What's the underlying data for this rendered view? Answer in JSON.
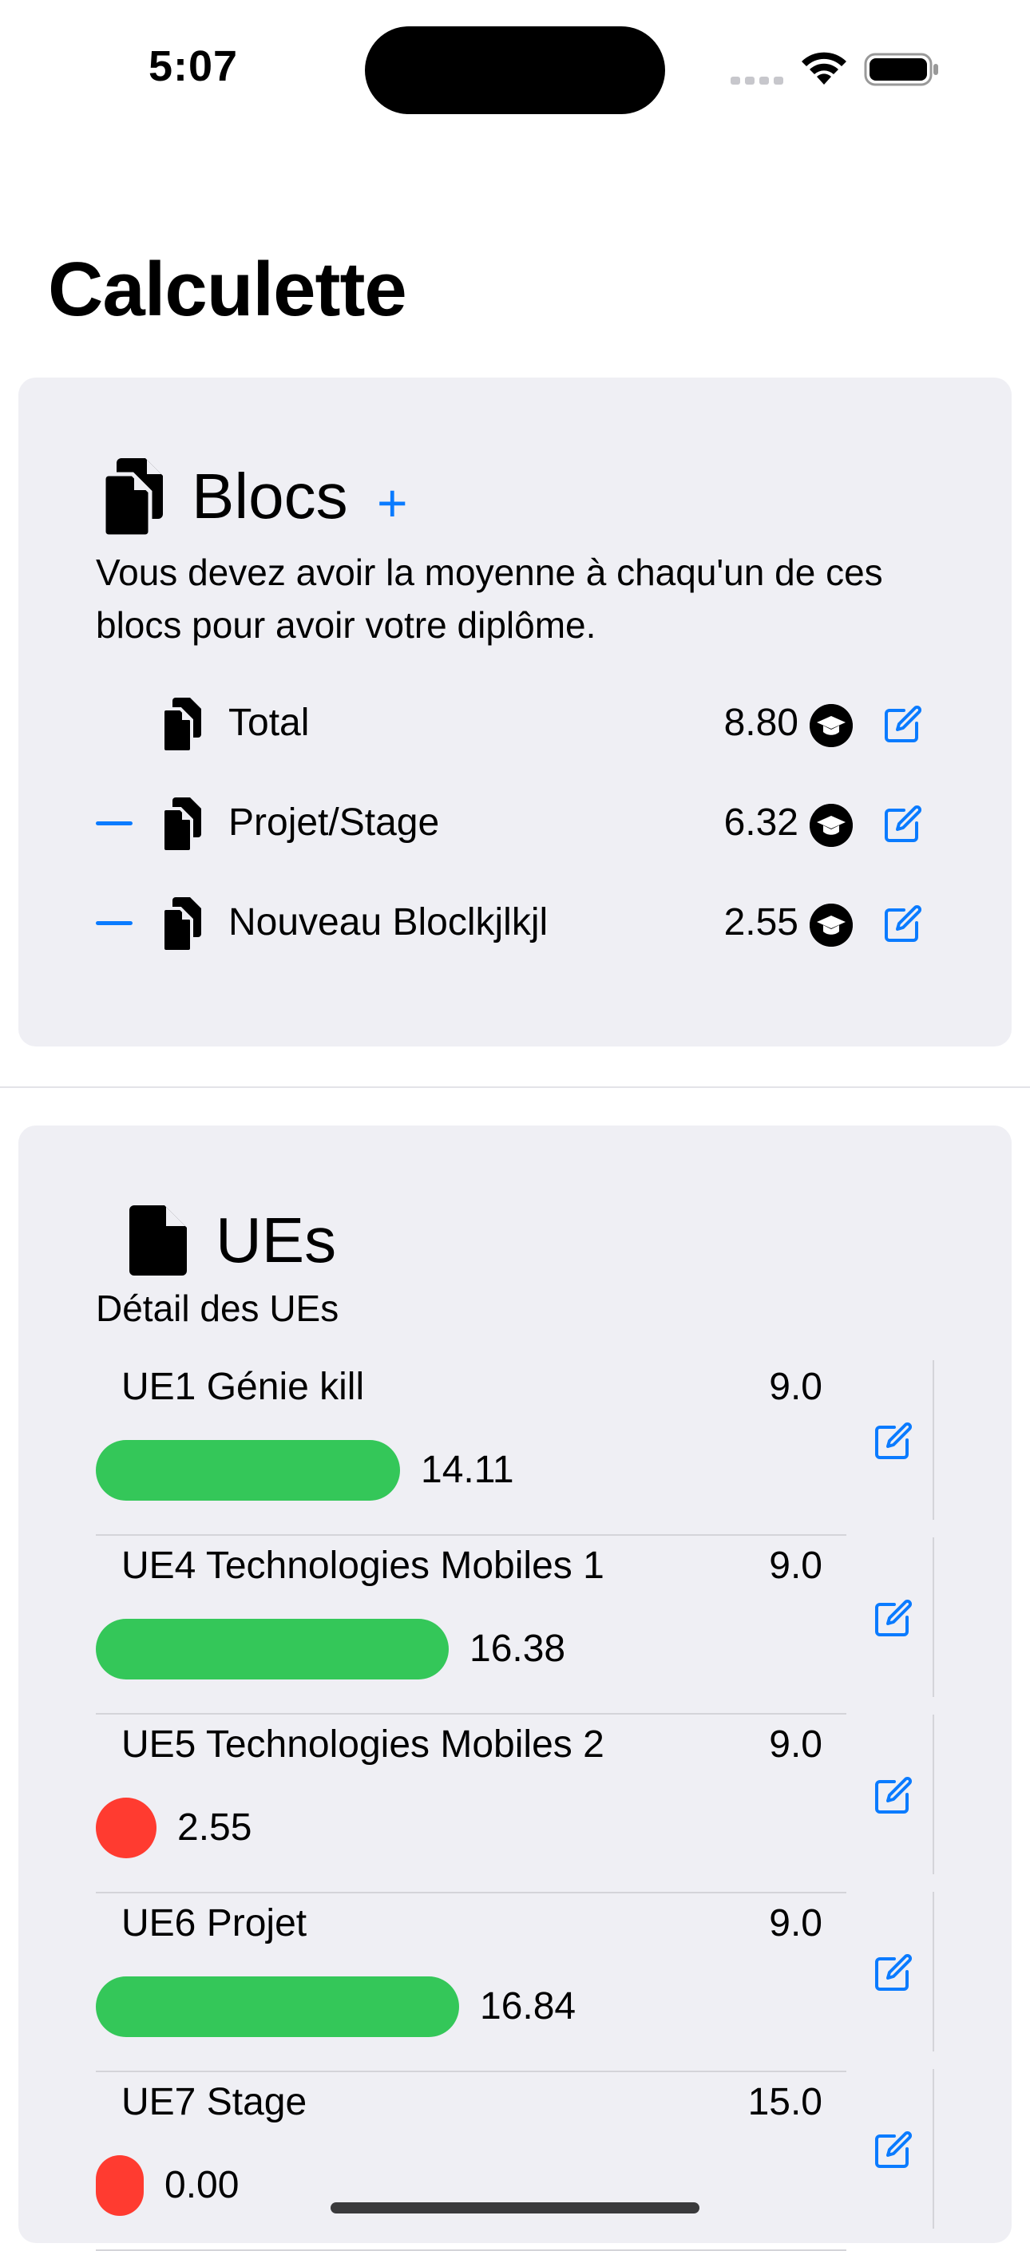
{
  "status": {
    "time": "5:07"
  },
  "page": {
    "title": "Calculette"
  },
  "blocs": {
    "title": "Blocs",
    "add_label": "+",
    "description": "Vous devez avoir la moyenne à chaqu'un de ces blocs pour avoir votre diplôme.",
    "rows": [
      {
        "label": "Total",
        "value": "8.80",
        "removable": false
      },
      {
        "label": "Projet/Stage",
        "value": "6.32",
        "removable": true
      },
      {
        "label": "Nouveau Bloclkjlkjl",
        "value": "2.55",
        "removable": true
      }
    ]
  },
  "ues": {
    "title": "UEs",
    "subtitle": "Détail des UEs",
    "rows": [
      {
        "name": "UE1 Génie kill",
        "coef": "9.0",
        "note": "14.11",
        "note_value": 14.11,
        "status": "pass"
      },
      {
        "name": "UE4 Technologies Mobiles 1",
        "coef": "9.0",
        "note": "16.38",
        "note_value": 16.38,
        "status": "pass"
      },
      {
        "name": "UE5 Technologies Mobiles 2",
        "coef": "9.0",
        "note": "2.55",
        "note_value": 2.55,
        "status": "fail"
      },
      {
        "name": "UE6 Projet",
        "coef": "9.0",
        "note": "16.84",
        "note_value": 16.84,
        "status": "pass"
      },
      {
        "name": "UE7 Stage",
        "coef": "15.0",
        "note": "0.00",
        "note_value": 0.0,
        "status": "fail"
      }
    ]
  },
  "colors": {
    "accent": "#0a7bff",
    "pass": "#34c759",
    "fail": "#ff3b30",
    "card": "#efeff4"
  }
}
